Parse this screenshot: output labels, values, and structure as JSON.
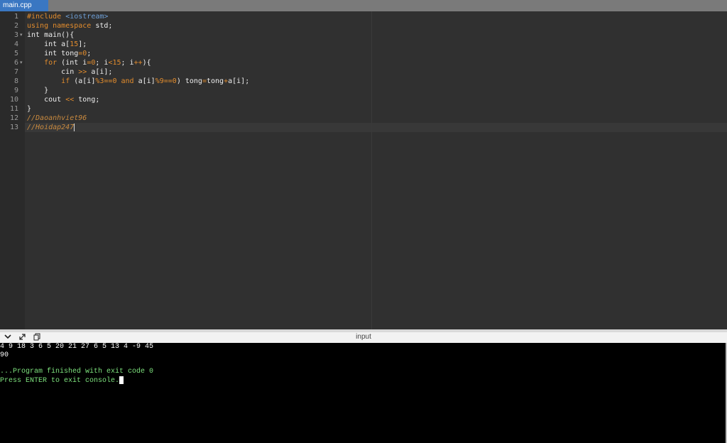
{
  "tab": {
    "label": "main.cpp"
  },
  "editor": {
    "line_numbers": [
      "1",
      "2",
      "3",
      "4",
      "5",
      "6",
      "7",
      "8",
      "9",
      "10",
      "11",
      "12",
      "13"
    ],
    "fold_marker": "▾"
  },
  "panel": {
    "title": "input",
    "icons": [
      "chevron-down-icon",
      "expand-icon",
      "copy-icon"
    ]
  },
  "console": {
    "input_line": "4 9 18 3 6 5 20 21 27 6 5 13 4 -9 45",
    "output_line": "90",
    "exit_line": "...Program finished with exit code 0",
    "prompt_line": "Press ENTER to exit console."
  },
  "colors": {
    "tab_accent": "#3a77c2",
    "keyword": "#e28c2d",
    "string": "#6e9fd6",
    "console_green": "#7ee37e"
  }
}
